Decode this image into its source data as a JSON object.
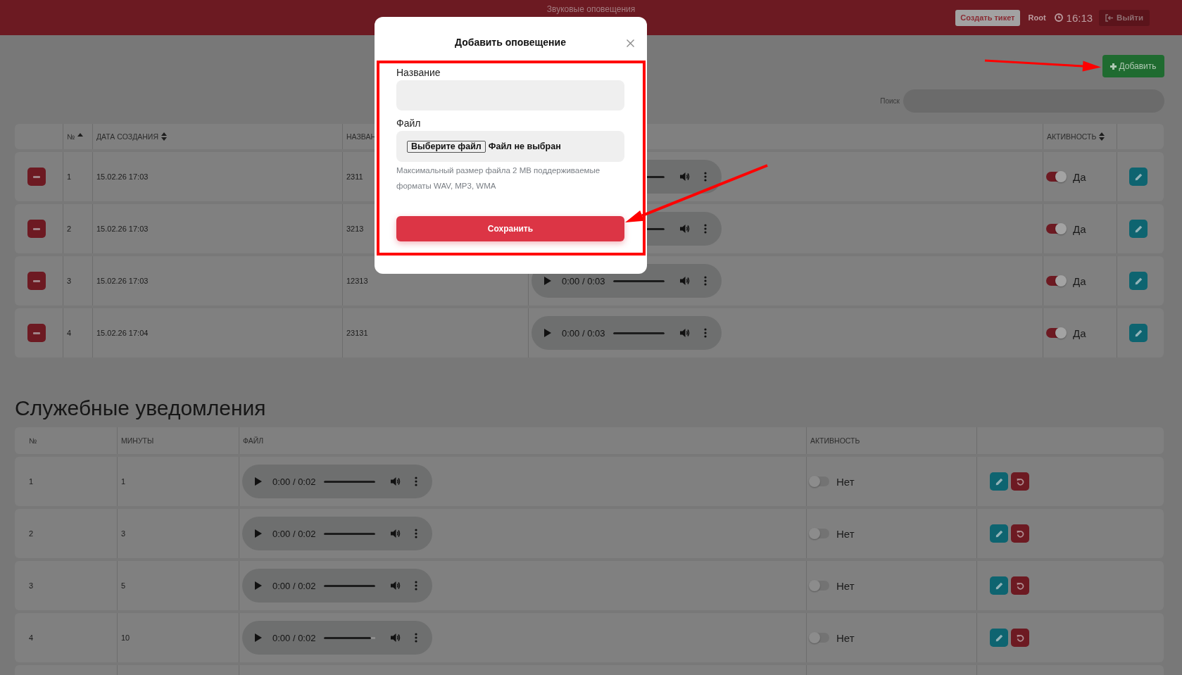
{
  "header": {
    "title": "Звуковые оповещения",
    "ticket_button": "Создать тикет",
    "user": "Root",
    "time": "16:13",
    "logout_button": "Выйти"
  },
  "toolbar": {
    "add_button": "Добавить",
    "search": {
      "label": "Поиск"
    }
  },
  "alerts_table": {
    "columns": [
      {
        "kind": "number",
        "label": "№",
        "sorted": true
      },
      {
        "kind": "date",
        "label": "ДАТА СОЗДАНИЯ",
        "sorted": false
      },
      {
        "kind": "name",
        "label": "НАЗВАН"
      },
      {
        "kind": "activity",
        "label": "АКТИВНОСТЬ",
        "sorted": false
      }
    ],
    "rows": [
      {
        "number": "1",
        "date": "15.02.26 17:03",
        "name": "2311",
        "player": {
          "level": 1
        },
        "active": true,
        "status": "Да"
      },
      {
        "number": "2",
        "date": "15.02.26 17:03",
        "name": "3213",
        "player": {
          "level": 1
        },
        "active": true,
        "status": "Да"
      },
      {
        "number": "3",
        "date": "15.02.26 17:03",
        "name": "12313",
        "player": {
          "time": "0:00 / 0:03",
          "level": 1
        },
        "active": true,
        "status": "Да"
      },
      {
        "number": "4",
        "date": "15.02.26 17:04",
        "name": "23131",
        "player": {
          "time": "0:00 / 0:03",
          "level": 1
        },
        "active": true,
        "status": "Да"
      }
    ]
  },
  "service_table": {
    "title": "Служебные уведомления",
    "columns": [
      {
        "kind": "number",
        "label": "№"
      },
      {
        "kind": "minutes",
        "label": "МИНУТЫ"
      },
      {
        "kind": "file",
        "label": "ФАЙЛ"
      },
      {
        "kind": "activity",
        "label": "АКТИВНОСТЬ"
      }
    ],
    "rows": [
      {
        "number": "1",
        "minutes": "1",
        "player": {
          "time": "0:00 / 0:02",
          "level": 1
        },
        "active": false,
        "status": "Нет"
      },
      {
        "number": "2",
        "minutes": "3",
        "player": {
          "time": "0:00 / 0:02",
          "level": 1
        },
        "active": false,
        "status": "Нет"
      },
      {
        "number": "3",
        "minutes": "5",
        "player": {
          "time": "0:00 / 0:02",
          "level": 1
        },
        "active": false,
        "status": "Нет"
      },
      {
        "number": "4",
        "minutes": "10",
        "player": {
          "time": "0:00 / 0:02",
          "level": 0.92
        },
        "active": false,
        "status": "Нет"
      }
    ]
  },
  "modal": {
    "title": "Добавить оповещение",
    "fields": [
      {
        "kind": "text",
        "label": "Название"
      },
      {
        "kind": "file",
        "label": "Файл",
        "button": "Выберите файл",
        "status": "Файл не выбран"
      }
    ],
    "hint": "Максимальный размер файла 2 MB поддерживаемые форматы WAV, MP3, WMA",
    "submit": "Сохранить"
  }
}
